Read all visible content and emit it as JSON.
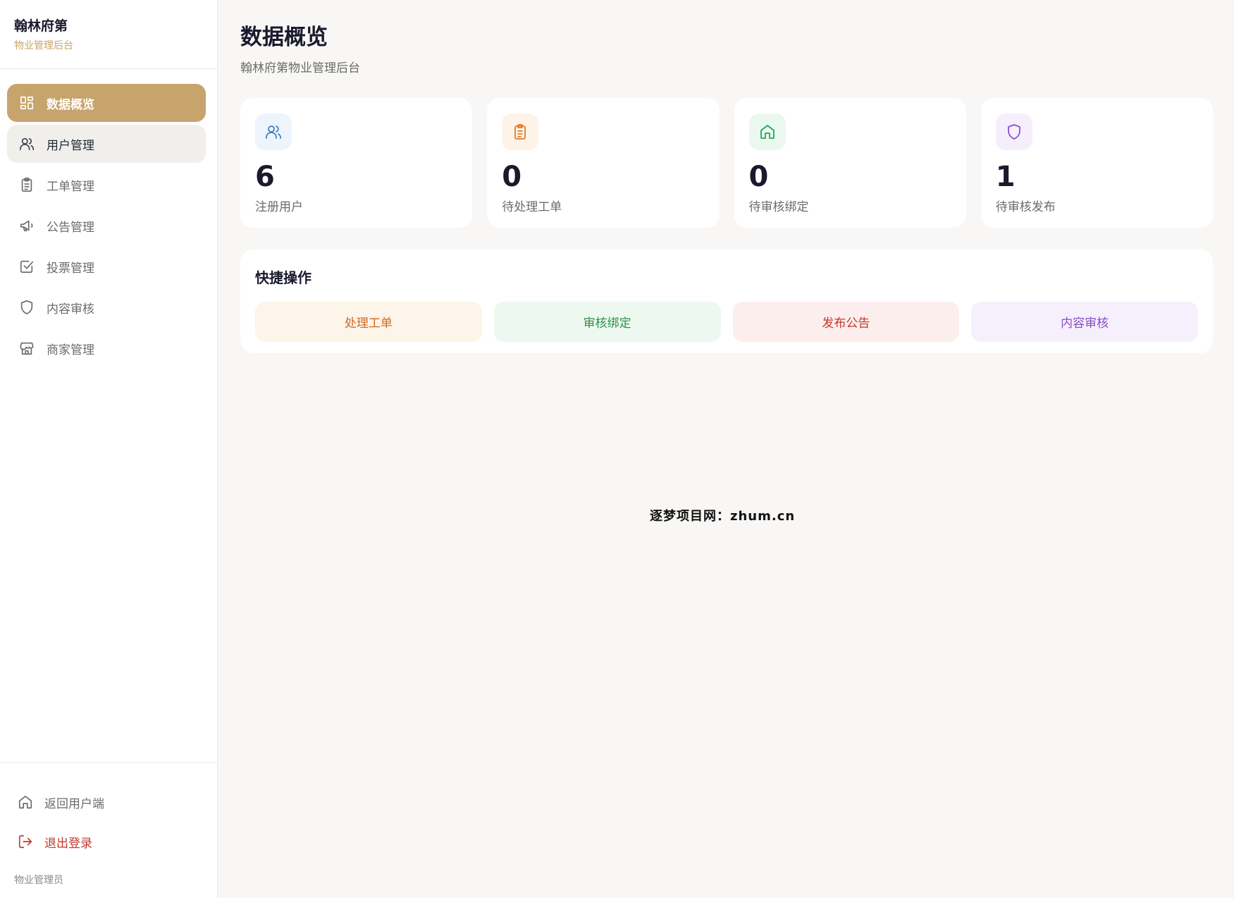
{
  "brand": {
    "title": "翰林府第",
    "subtitle": "物业管理后台"
  },
  "nav": [
    {
      "label": "数据概览",
      "icon": "dashboard-icon",
      "state": "active"
    },
    {
      "label": "用户管理",
      "icon": "users-icon",
      "state": "hover"
    },
    {
      "label": "工单管理",
      "icon": "clipboard-icon",
      "state": "normal"
    },
    {
      "label": "公告管理",
      "icon": "megaphone-icon",
      "state": "normal"
    },
    {
      "label": "投票管理",
      "icon": "checkbox-icon",
      "state": "normal"
    },
    {
      "label": "内容审核",
      "icon": "shield-icon",
      "state": "normal"
    },
    {
      "label": "商家管理",
      "icon": "store-icon",
      "state": "normal"
    }
  ],
  "bottom": {
    "back_label": "返回用户端",
    "logout_label": "退出登录",
    "role": "物业管理员"
  },
  "header": {
    "title": "数据概览",
    "subtitle": "翰林府第物业管理后台"
  },
  "stats": [
    {
      "value": "6",
      "label": "注册用户",
      "icon": "users-icon",
      "color": "#3b82c4",
      "bg": "#eef4fc"
    },
    {
      "value": "0",
      "label": "待处理工单",
      "icon": "clipboard-icon",
      "color": "#e07b24",
      "bg": "#fdf3e9"
    },
    {
      "value": "0",
      "label": "待审核绑定",
      "icon": "home-icon",
      "color": "#22a55a",
      "bg": "#ebf8ef"
    },
    {
      "value": "1",
      "label": "待审核发布",
      "icon": "shield-icon",
      "color": "#8b4fd6",
      "bg": "#f5effc"
    }
  ],
  "quick": {
    "title": "快捷操作",
    "actions": [
      {
        "label": "处理工单",
        "color": "#d2691e",
        "bg": "#fdf4ea"
      },
      {
        "label": "审核绑定",
        "color": "#2f8f4a",
        "bg": "#edf9f0"
      },
      {
        "label": "发布公告",
        "color": "#c0392b",
        "bg": "#fdeeee"
      },
      {
        "label": "内容审核",
        "color": "#8a4bc8",
        "bg": "#f6f0fc"
      }
    ]
  },
  "watermark": "逐梦项目网：zhum.cn"
}
